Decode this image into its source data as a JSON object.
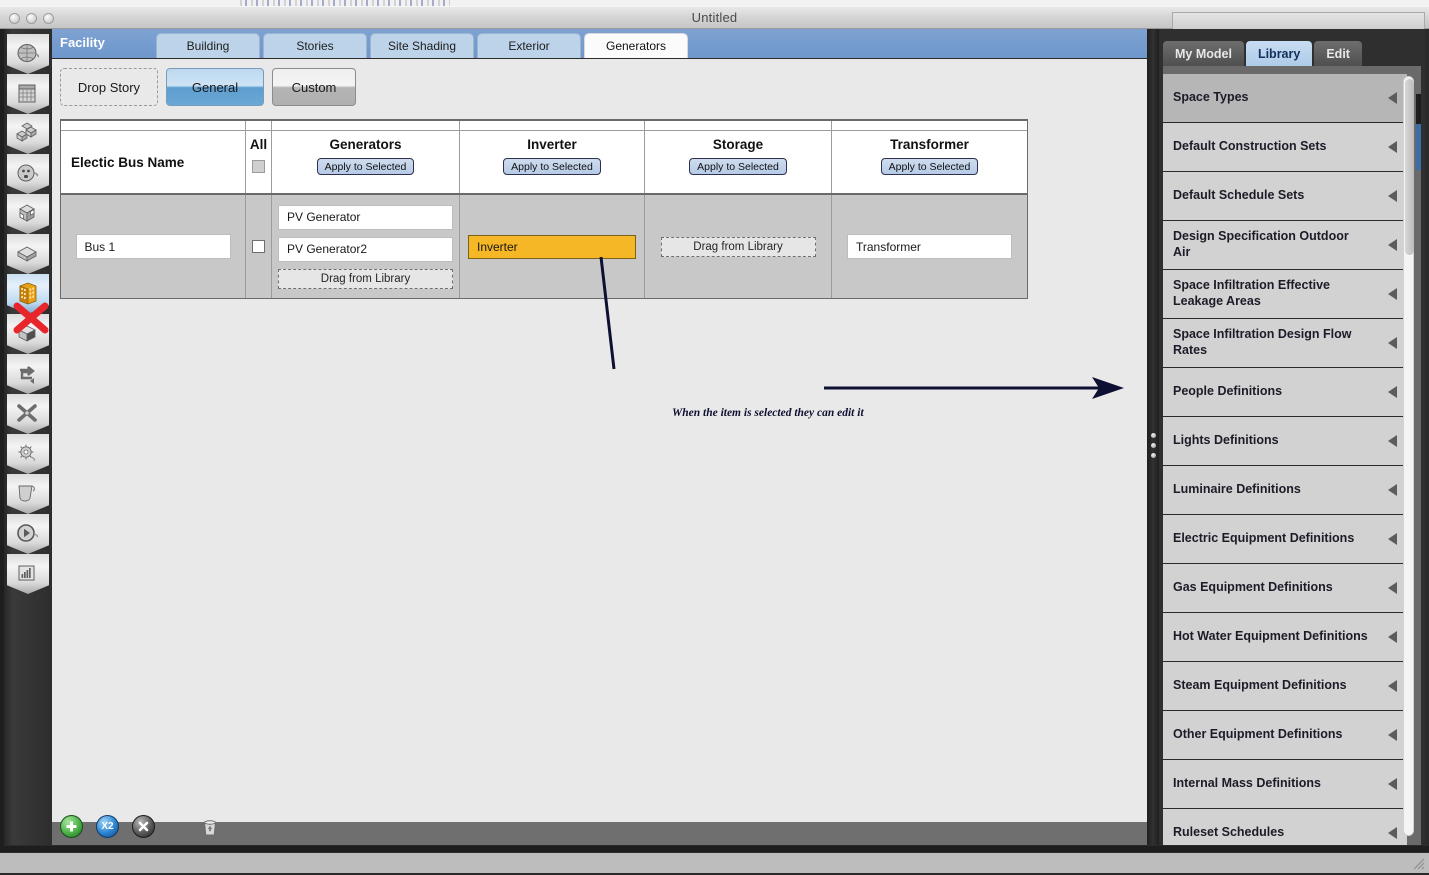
{
  "window": {
    "title": "Untitled",
    "traffic_lights": [
      "close",
      "minimize",
      "zoom"
    ]
  },
  "left_rail": {
    "items": [
      {
        "name": "site-icon",
        "selected": false
      },
      {
        "name": "schedules-icon",
        "selected": false
      },
      {
        "name": "constructions-icon",
        "selected": false
      },
      {
        "name": "loads-icon",
        "selected": false
      },
      {
        "name": "space-types-icon",
        "selected": false
      },
      {
        "name": "facility-geometry-icon",
        "selected": false
      },
      {
        "name": "facility-building-icon",
        "selected": true
      },
      {
        "name": "spaces-icon",
        "selected": false
      },
      {
        "name": "thermal-zones-icon",
        "selected": false
      },
      {
        "name": "hvac-systems-icon",
        "selected": false
      },
      {
        "name": "variables-icon",
        "selected": false
      },
      {
        "name": "simulation-settings-icon",
        "selected": false
      },
      {
        "name": "run-simulation-icon",
        "selected": false
      },
      {
        "name": "results-summary-icon",
        "selected": false
      }
    ]
  },
  "editor": {
    "section_label": "Facility",
    "tabs": [
      {
        "label": "Building",
        "active": false
      },
      {
        "label": "Stories",
        "active": false
      },
      {
        "label": "Site Shading",
        "active": false
      },
      {
        "label": "Exterior",
        "active": false
      },
      {
        "label": "Generators",
        "active": true
      }
    ],
    "mode_buttons": [
      {
        "label": "Drop Story",
        "style": "dashed"
      },
      {
        "label": "General",
        "style": "active"
      },
      {
        "label": "Custom",
        "style": "normal"
      }
    ],
    "table": {
      "columns": [
        {
          "header": "Electic Bus Name",
          "apply_label": null,
          "has_checkbox": false
        },
        {
          "header": "All",
          "apply_label": null,
          "has_checkbox": true
        },
        {
          "header": "Generators",
          "apply_label": "Apply to Selected",
          "has_checkbox": false
        },
        {
          "header": "Inverter",
          "apply_label": "Apply to Selected",
          "has_checkbox": false
        },
        {
          "header": "Storage",
          "apply_label": "Apply to Selected",
          "has_checkbox": false
        },
        {
          "header": "Transformer",
          "apply_label": "Apply to Selected",
          "has_checkbox": false
        }
      ],
      "rows": [
        {
          "bus_name": "Bus 1",
          "row_checked": false,
          "generators": [
            "PV Generator",
            "PV Generator2"
          ],
          "generators_drop_label": "Drag from Library",
          "inverter": "Inverter",
          "inverter_selected": true,
          "storage": null,
          "storage_drop_label": "Drag from Library",
          "transformer": "Transformer"
        }
      ]
    },
    "annotation": {
      "text": "When the item is selected they can edit it"
    },
    "footer_buttons": [
      {
        "name": "add-button",
        "label": "+"
      },
      {
        "name": "duplicate-button",
        "label": "X2"
      },
      {
        "name": "remove-button",
        "label": "×"
      },
      {
        "name": "purge-button",
        "label": ""
      }
    ]
  },
  "library": {
    "tabs": [
      {
        "label": "My Model",
        "active": false
      },
      {
        "label": "Library",
        "active": true
      },
      {
        "label": "Edit",
        "active": false
      }
    ],
    "items": [
      {
        "label": "Space Types",
        "selected": true,
        "two_line": false
      },
      {
        "label": "Default Construction Sets",
        "selected": false,
        "two_line": false
      },
      {
        "label": "Default Schedule Sets",
        "selected": false,
        "two_line": false
      },
      {
        "label": "Design Specification Outdoor Air",
        "selected": false,
        "two_line": false
      },
      {
        "label": "Space Infiltration Effective Leakage Areas",
        "selected": false,
        "two_line": true
      },
      {
        "label": "Space Infiltration Design Flow Rates",
        "selected": false,
        "two_line": true
      },
      {
        "label": "People Definitions",
        "selected": false,
        "two_line": false
      },
      {
        "label": "Lights Definitions",
        "selected": false,
        "two_line": false
      },
      {
        "label": "Luminaire Definitions",
        "selected": false,
        "two_line": false
      },
      {
        "label": "Electric Equipment Definitions",
        "selected": false,
        "two_line": false
      },
      {
        "label": "Gas Equipment Definitions",
        "selected": false,
        "two_line": false
      },
      {
        "label": "Hot Water Equipment Definitions",
        "selected": false,
        "two_line": false
      },
      {
        "label": "Steam Equipment Definitions",
        "selected": false,
        "two_line": false
      },
      {
        "label": "Other Equipment Definitions",
        "selected": false,
        "two_line": false
      },
      {
        "label": "Internal Mass Definitions",
        "selected": false,
        "two_line": false
      },
      {
        "label": "Ruleset Schedules",
        "selected": false,
        "two_line": false
      }
    ]
  },
  "colors": {
    "selected_cell": "#f5b726",
    "tab_strip": "#6f97cc",
    "active_mode": "#6aa7d4",
    "annotation": "#0d1030",
    "library_item": "#d2d2d2",
    "library_selected": "#b6b6b6"
  }
}
